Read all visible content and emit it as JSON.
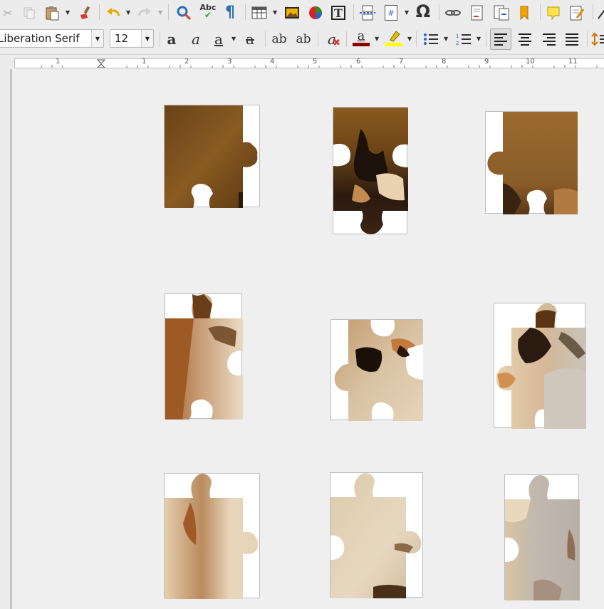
{
  "toolbar": {
    "cut_icon": "scissors-icon",
    "copy_icon": "copy-icon",
    "paste_icon": "clipboard-icon",
    "clone_icon": "paintbrush-icon",
    "undo_icon": "undo-icon",
    "redo_icon": "redo-icon",
    "find_icon": "find-replace-icon",
    "spell_label": "Abc",
    "formatting_marks_label": "¶",
    "table_icon": "table-icon",
    "image_icon": "image-icon",
    "chart_icon": "chart-icon",
    "textbox_label": "T",
    "pagebreak_icon": "page-break-icon",
    "field_label": "#",
    "special_char_label": "Ω",
    "hyperlink_icon": "hyperlink-icon",
    "footnote_icon": "footnote-icon",
    "crossref_icon": "cross-reference-icon",
    "bookmark_icon": "bookmark-icon",
    "comment_icon": "comment-icon",
    "track_changes_icon": "track-changes-icon"
  },
  "format": {
    "font_name": "Liberation Serif",
    "font_size": "12",
    "bold_label": "a",
    "italic_label": "a",
    "underline_label": "a",
    "strike_label": "a",
    "superscript_label": "ab",
    "subscript_label": "ab",
    "clear_format_label": "a",
    "font_color_label": "a",
    "font_color": "#8b0000",
    "highlight_color": "#ffff00"
  },
  "ruler": {
    "numbers": [
      "1",
      "1",
      "2",
      "3",
      "4",
      "5",
      "6",
      "7",
      "8",
      "9",
      "10",
      "11"
    ]
  },
  "document": {
    "pieces": [
      {
        "name": "puzzle-piece-1",
        "row": 1,
        "col": 1
      },
      {
        "name": "puzzle-piece-2",
        "row": 1,
        "col": 2
      },
      {
        "name": "puzzle-piece-3",
        "row": 1,
        "col": 3
      },
      {
        "name": "puzzle-piece-4",
        "row": 2,
        "col": 1
      },
      {
        "name": "puzzle-piece-5",
        "row": 2,
        "col": 2
      },
      {
        "name": "puzzle-piece-6",
        "row": 2,
        "col": 3
      },
      {
        "name": "puzzle-piece-7",
        "row": 3,
        "col": 1
      },
      {
        "name": "puzzle-piece-8",
        "row": 3,
        "col": 2
      },
      {
        "name": "puzzle-piece-9",
        "row": 3,
        "col": 3
      }
    ]
  }
}
